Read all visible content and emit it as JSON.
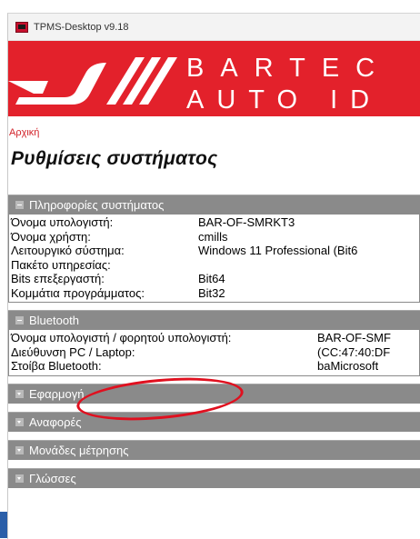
{
  "window": {
    "title": "TPMS-Desktop v9.18",
    "icon": "app-icon"
  },
  "brand": {
    "line1": "BARTEC",
    "line2": "AUTO ID",
    "color": "#e3212b"
  },
  "breadcrumb": "Αρχική",
  "page_title": "Ρυθμίσεις συστήματος",
  "sections": {
    "system_info": {
      "title": "Πληροφορίες συστήματος",
      "rows": [
        {
          "key": "Όνομα υπολογιστή:",
          "value": "BAR-OF-SMRKT3"
        },
        {
          "key": "Όνομα χρήστη:",
          "value": "cmills"
        },
        {
          "key": "Λειτουργικό σύστημα:",
          "value": "Windows 11 Professional (Bit6"
        },
        {
          "key": "Πακέτο υπηρεσίας:",
          "value": ""
        },
        {
          "key": "Bits επεξεργαστή:",
          "value": "Bit64"
        },
        {
          "key": "Κομμάτια προγράμματος:",
          "value": "Bit32"
        }
      ]
    },
    "bluetooth": {
      "title": "Bluetooth",
      "rows": [
        {
          "key": "Όνομα υπολογιστή / φορητού υπολογιστή:",
          "value": "BAR-OF-SMF"
        },
        {
          "key": "Διεύθυνση PC / Laptop:",
          "value": "(CC:47:40:DF"
        },
        {
          "key": "Στοίβα Bluetooth:",
          "value": "baMicrosoft"
        }
      ]
    },
    "collapsed": [
      {
        "title": "Εφαρμογή"
      },
      {
        "title": "Αναφορές"
      },
      {
        "title": "Μονάδες μέτρησης"
      },
      {
        "title": "Γλώσσες"
      }
    ]
  },
  "colors": {
    "accent": "#d2232a",
    "section_header": "#8a8a8a",
    "annotation": "#e0101f"
  }
}
